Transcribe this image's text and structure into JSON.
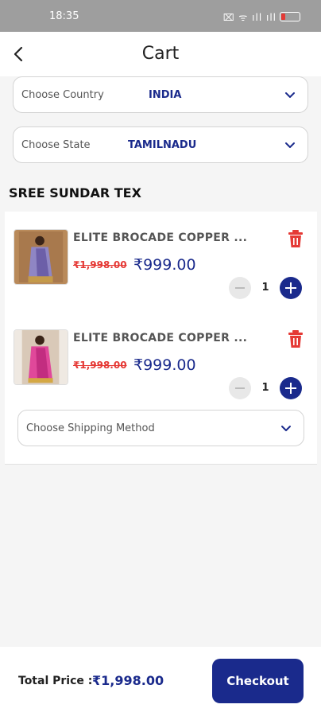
{
  "status_bar": {
    "time": "18:35",
    "indicators": "⌧ ᯤ ıll ıll"
  },
  "header": {
    "title": "Cart",
    "back_icon": "chevron-left-icon"
  },
  "address": {
    "country": {
      "label": "Choose Country",
      "value": "INDIA"
    },
    "state": {
      "label": "Choose State",
      "value": "TAMILNADU"
    }
  },
  "seller": {
    "name": "SREE SUNDAR TEX"
  },
  "cart": {
    "items": [
      {
        "name": "ELITE BROCADE COPPER ...",
        "old_price": "₹1,998.00",
        "price": "₹999.00",
        "qty": "1"
      },
      {
        "name": "ELITE BROCADE COPPER ...",
        "old_price": "₹1,998.00",
        "price": "₹999.00",
        "qty": "1"
      }
    ],
    "shipping": {
      "label": "Choose Shipping Method"
    }
  },
  "footer": {
    "total_label": "Total Price :",
    "total_value": "₹1,998.00",
    "checkout_label": "Checkout"
  },
  "colors": {
    "primary": "#1a2a8c",
    "accent_red": "#e53935",
    "background": "#f5f5f5"
  }
}
